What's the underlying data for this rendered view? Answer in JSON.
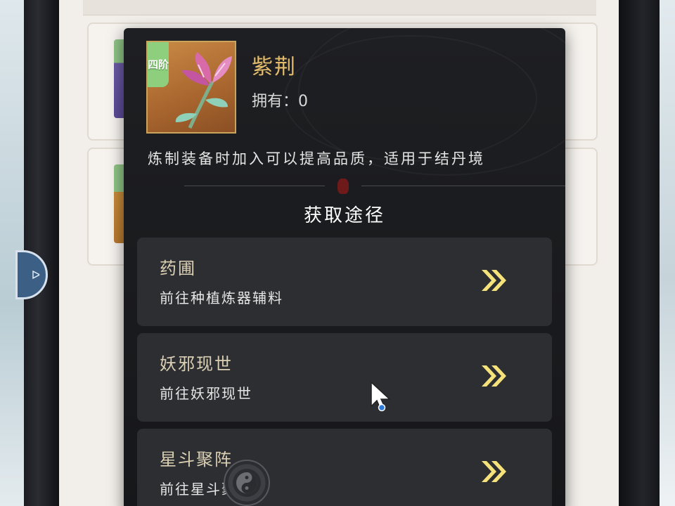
{
  "item": {
    "tier": "四阶",
    "name": "紫荆",
    "owned_label": "拥有：",
    "owned_count": "0",
    "description": "炼制装备时加入可以提高品质，适用于结丹境"
  },
  "section_title": "获取途径",
  "routes": [
    {
      "title": "药圃",
      "subtitle": "前往种植炼器辅料",
      "icon": "double-chevron-right-icon"
    },
    {
      "title": "妖邪现世",
      "subtitle": "前往妖邪现世",
      "icon": "double-chevron-right-icon"
    },
    {
      "title": "星斗聚阵",
      "subtitle": "前往星斗聚阵",
      "icon": "double-chevron-right-icon"
    }
  ],
  "colors": {
    "accent_gold": "#e2bb6c",
    "chevron_yellow": "#f5e27a",
    "tier_green": "#8ecf7e",
    "popup_bg": "#1e1f22",
    "route_bg": "#2c2e32"
  }
}
